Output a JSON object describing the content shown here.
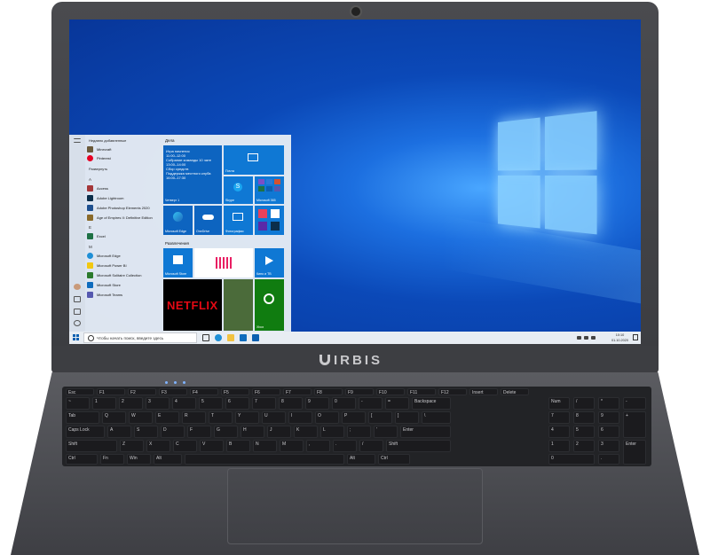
{
  "brand": {
    "name": "IRBIS"
  },
  "start_menu": {
    "recent_title": "Недавно добавленные",
    "expand_label": "Развернуть",
    "recent_apps": [
      "Minecraft",
      "Pinterest"
    ],
    "letter_a": "A",
    "apps_a": [
      "Access",
      "Adobe Lightroom",
      "Adobe Photoshop Elements 2020",
      "Age of Empires II: Definitive Edition"
    ],
    "letter_e": "E",
    "apps_e": [
      "Excel"
    ],
    "letter_m": "M",
    "apps_m": [
      "Microsoft Edge",
      "Microsoft Power BI",
      "Microsoft Solitaire Collection",
      "Microsoft Store",
      "Microsoft Teams"
    ],
    "group_business": "Дела",
    "group_entertainment": "Развлечения",
    "calendar_lines": [
      "Игра начнется",
      "11:00–12:00",
      "Собрание команды 10 чате",
      "13:00–14:00",
      "Сбор средств",
      "Поддержка местного клуба",
      "16:00–17:30"
    ],
    "tiles": {
      "calendar": "Четверг 1",
      "mail": "Почта",
      "skype": "Skype",
      "m365": "Microsoft 365",
      "edge": "Microsoft Edge",
      "onedrive": "OneDrive",
      "photos": "Фотографии",
      "store": "Microsoft Store",
      "spotify": "",
      "skype_tv": "Кино и ТВ",
      "netflix": "NETFLIX",
      "xbox": "Xbox"
    }
  },
  "taskbar": {
    "search_placeholder": "Чтобы начать поиск, введите здесь",
    "time": "10:10",
    "date": "01.10.2020"
  },
  "keyboard": {
    "row_fn": [
      "Esc",
      "F1",
      "F2",
      "F3",
      "F4",
      "F5",
      "F6",
      "F7",
      "F8",
      "F9",
      "F10",
      "F11",
      "F12",
      "Insert",
      "Delete"
    ],
    "row_num": [
      "~",
      "1",
      "2",
      "3",
      "4",
      "5",
      "6",
      "7",
      "8",
      "9",
      "0",
      "-",
      "=",
      "Backspace"
    ],
    "row_q": [
      "Tab",
      "Q",
      "W",
      "E",
      "R",
      "T",
      "Y",
      "U",
      "I",
      "O",
      "P",
      "[",
      "]",
      "\\"
    ],
    "row_a": [
      "Caps Lock",
      "A",
      "S",
      "D",
      "F",
      "G",
      "H",
      "J",
      "K",
      "L",
      ";",
      "'",
      "Enter"
    ],
    "row_z": [
      "Shift",
      "Z",
      "X",
      "C",
      "V",
      "B",
      "N",
      "M",
      ",",
      ".",
      "/",
      "Shift"
    ],
    "row_space": [
      "Ctrl",
      "Fn",
      "Win",
      "Alt",
      "",
      "Alt",
      "Ctrl"
    ],
    "numpad": [
      "Num",
      "/",
      "*",
      "-",
      "7",
      "8",
      "9",
      "+",
      "4",
      "5",
      "6",
      "1",
      "2",
      "3",
      "Enter",
      "0",
      "."
    ]
  }
}
